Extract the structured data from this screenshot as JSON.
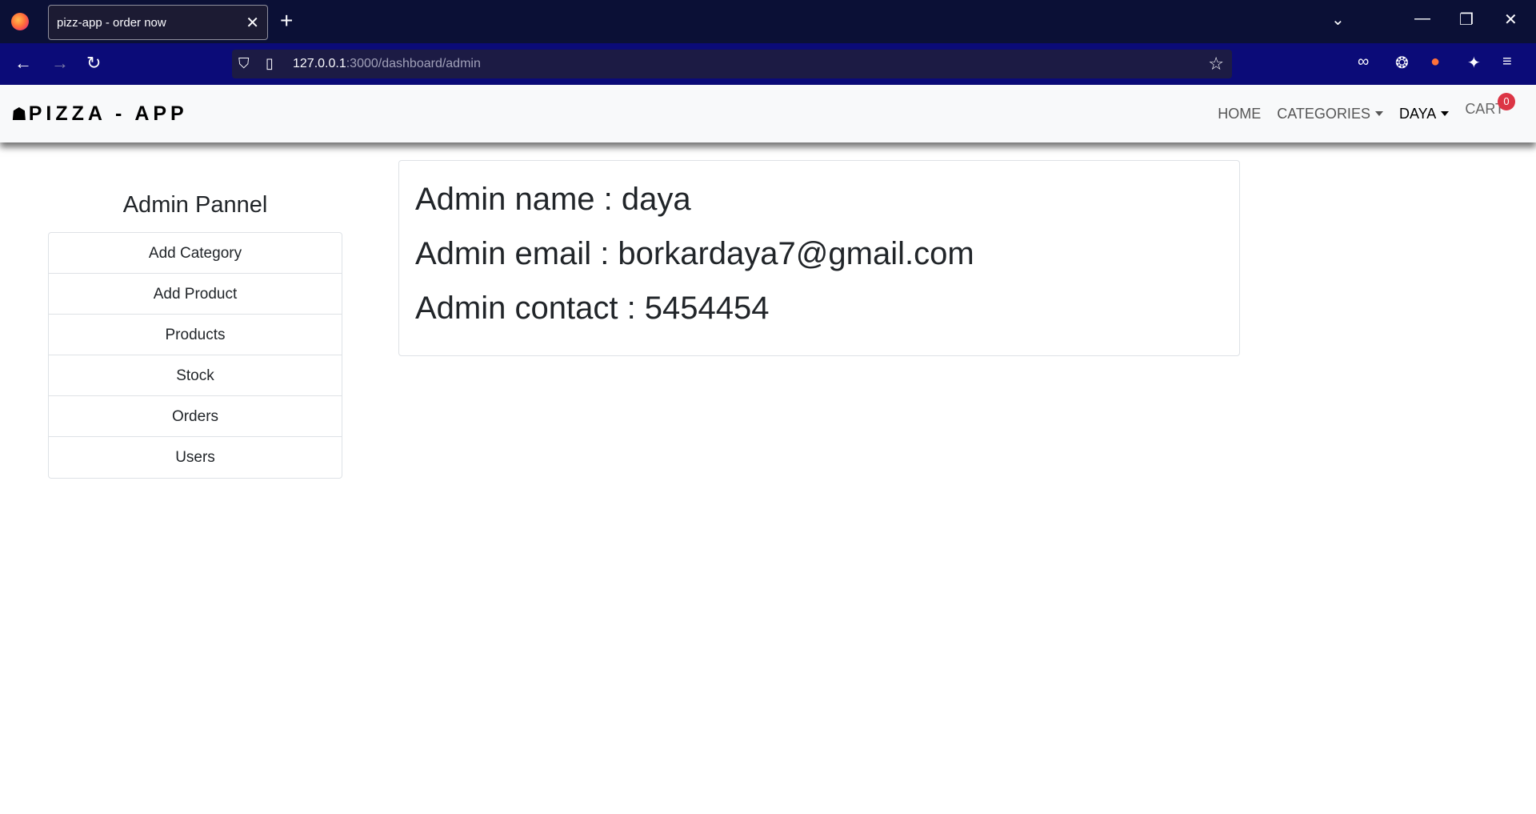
{
  "browser": {
    "tab_title": "pizz-app - order now",
    "url_host": "127.0.0.1",
    "url_path": ":3000/dashboard/admin"
  },
  "app": {
    "brand": "PIZZA - APP",
    "nav": {
      "home": "HOME",
      "categories": "CATEGORIES",
      "user": "DAYA",
      "cart": "CART",
      "cart_count": "0"
    }
  },
  "admin_panel": {
    "title": "Admin Pannel",
    "items": [
      "Add Category",
      "Add Product",
      "Products",
      "Stock",
      "Orders",
      "Users"
    ]
  },
  "admin_info": {
    "name_line": "Admin name : daya",
    "email_line": "Admin email : borkardaya7@gmail.com",
    "contact_line": "Admin contact : 5454454"
  }
}
